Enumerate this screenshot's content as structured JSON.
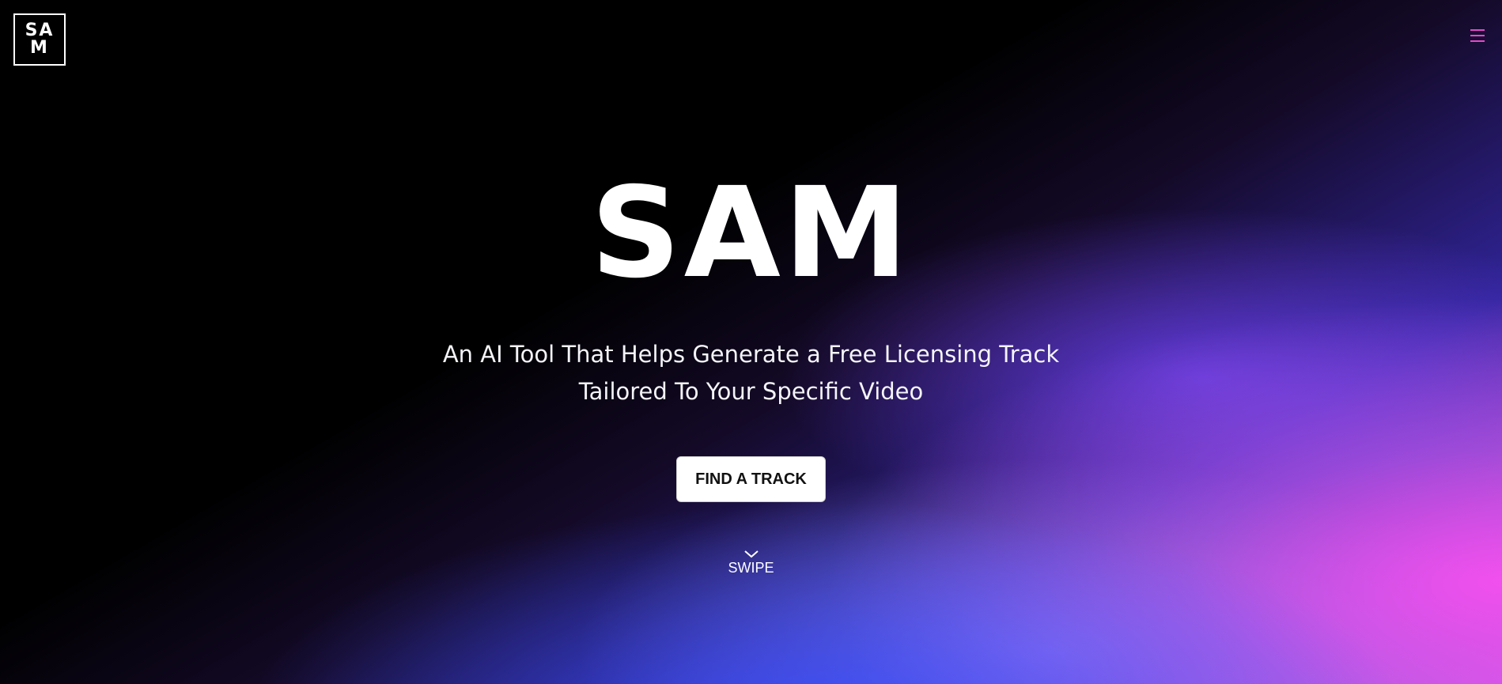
{
  "logo": {
    "line1": "SA",
    "line2": "M"
  },
  "header": {
    "menu_icon": "hamburger-menu-icon",
    "accent_color": "#e848c8"
  },
  "hero": {
    "title": "SAM",
    "subtitle_line1": "An AI Tool That Helps Generate a Free Licensing Track",
    "subtitle_line2": "Tailored To Your Specific Video",
    "cta_label": "FIND A TRACK",
    "swipe_label": "SWIPE",
    "swipe_icon": "chevron-down-icon"
  },
  "colors": {
    "background": "#000000",
    "gradient_blue": "#4a5cff",
    "gradient_violet": "#7a4cff",
    "gradient_pink": "#f052ee"
  }
}
